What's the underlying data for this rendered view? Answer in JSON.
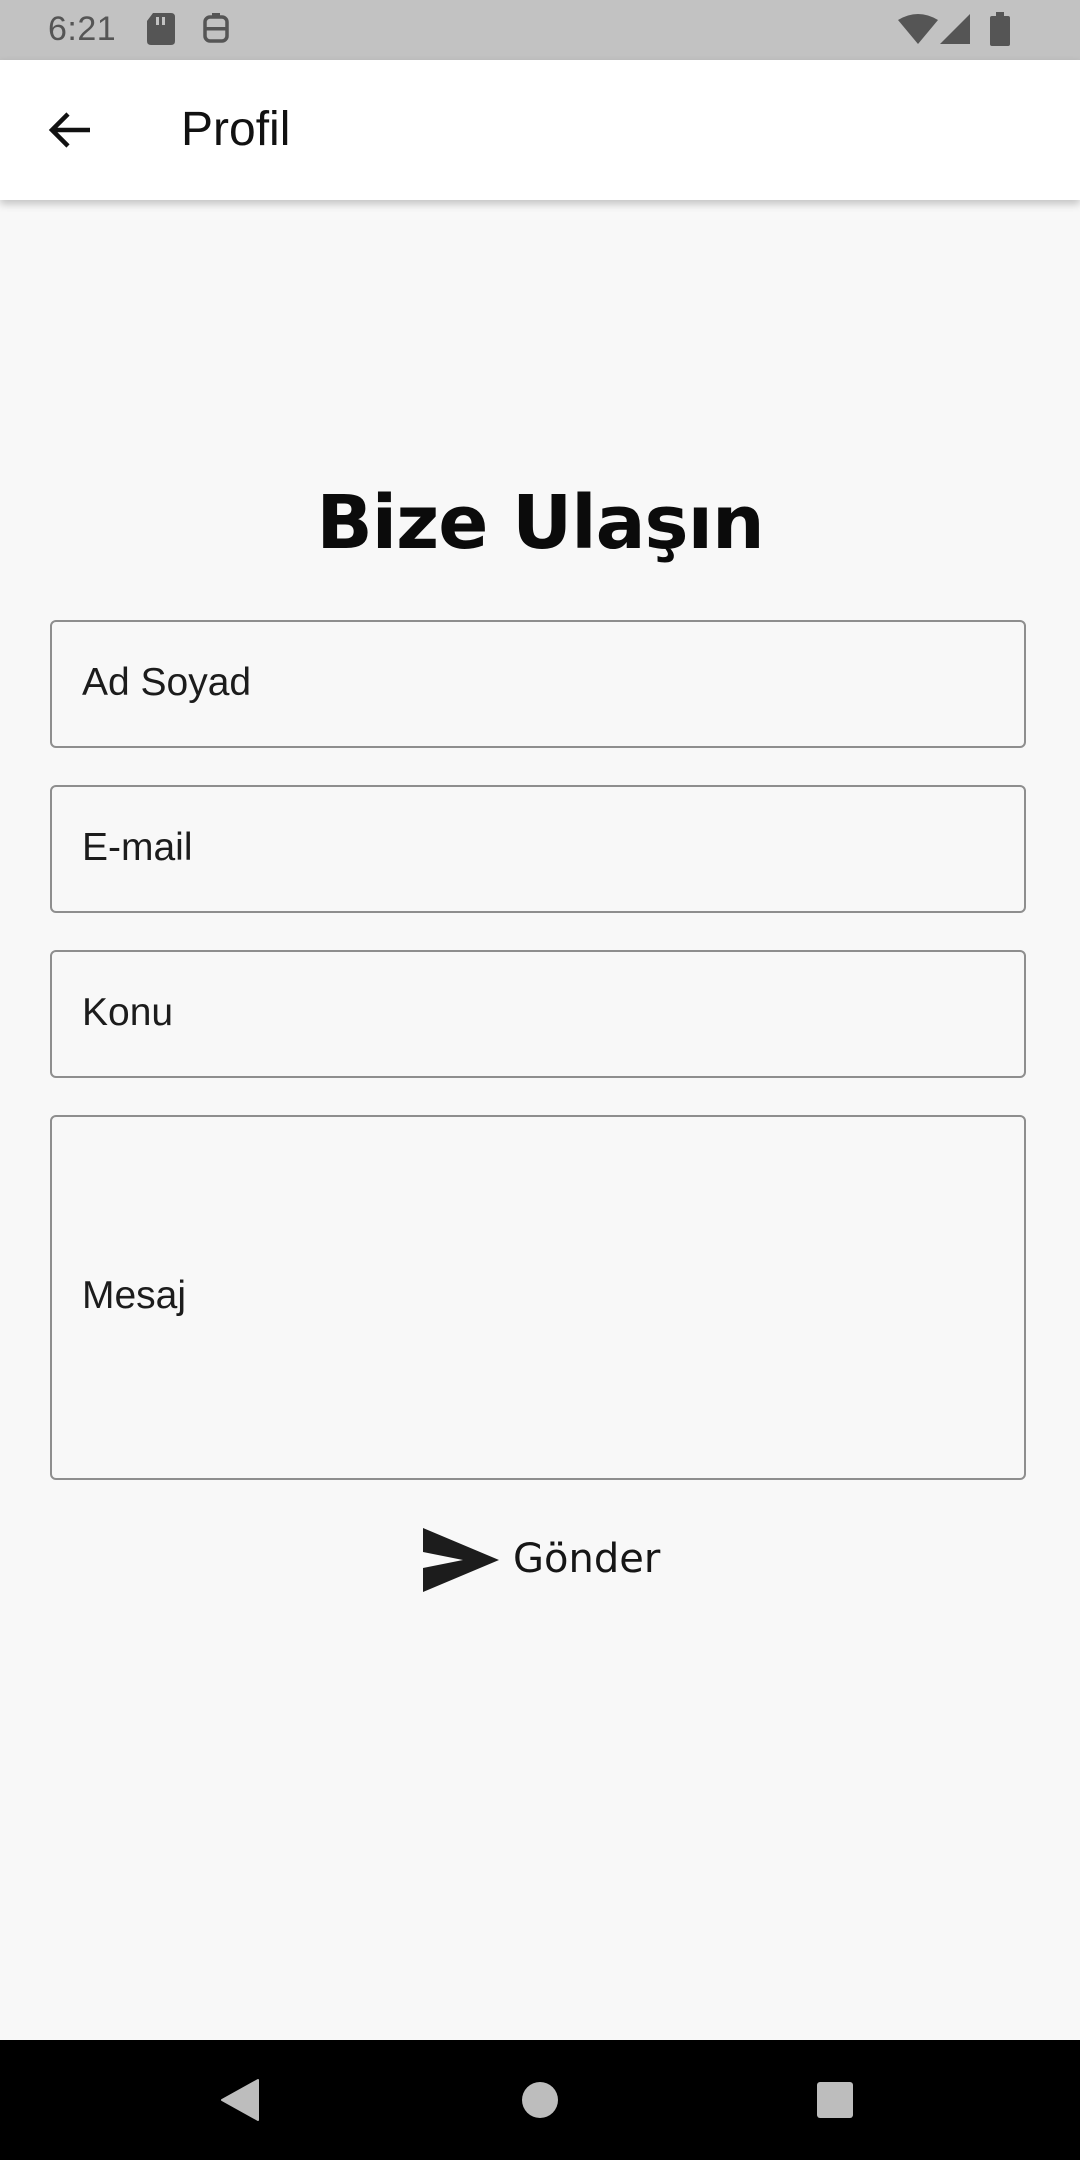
{
  "status_bar": {
    "time": "6:21",
    "icons_left": [
      "sd-card-icon",
      "robot-icon"
    ],
    "icons_right": [
      "wifi-icon",
      "signal-icon",
      "battery-icon"
    ],
    "background": "#c2c2c2"
  },
  "app_bar": {
    "back_icon": "arrow-left-icon",
    "title": "Profil"
  },
  "form": {
    "heading": "Bize Ulaşın",
    "fields": [
      {
        "name": "name",
        "placeholder": "Ad Soyad"
      },
      {
        "name": "email",
        "placeholder": "E-mail"
      },
      {
        "name": "subject",
        "placeholder": "Konu"
      },
      {
        "name": "message",
        "placeholder": "Mesaj"
      }
    ],
    "submit": {
      "icon": "send-icon",
      "label": "Gönder"
    }
  },
  "nav_bar": {
    "buttons": [
      "back-triangle-icon",
      "home-circle-icon",
      "recents-square-icon"
    ]
  },
  "colors": {
    "background": "#f8f8f8",
    "app_bar": "#ffffff",
    "field_border": "#8e8e8e",
    "nav_bar": "#000000"
  }
}
